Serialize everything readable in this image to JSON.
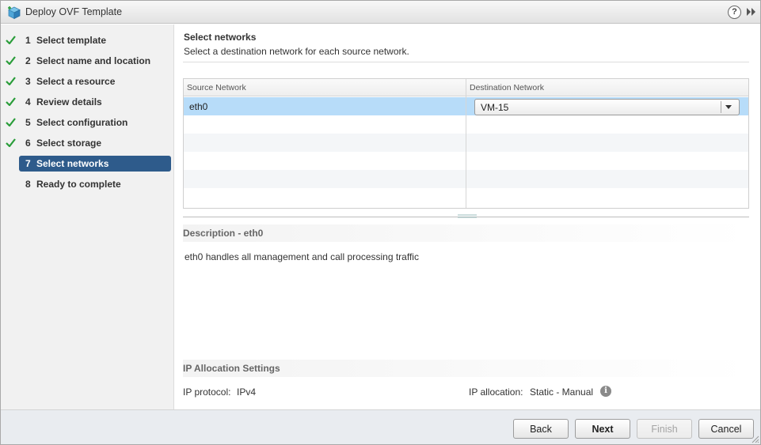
{
  "window": {
    "title": "Deploy OVF Template",
    "help_symbol": "?"
  },
  "colors": {
    "accent": "#2e5b8b",
    "check": "#2a9d3a",
    "selected_row": "#b7dcf9"
  },
  "steps": [
    {
      "num": "1",
      "label": "Select template",
      "done": true
    },
    {
      "num": "2",
      "label": "Select name and location",
      "done": true
    },
    {
      "num": "3",
      "label": "Select a resource",
      "done": true
    },
    {
      "num": "4",
      "label": "Review details",
      "done": true
    },
    {
      "num": "5",
      "label": "Select configuration",
      "done": true
    },
    {
      "num": "6",
      "label": "Select storage",
      "done": true
    },
    {
      "num": "7",
      "label": "Select networks",
      "done": false,
      "active": true
    },
    {
      "num": "8",
      "label": "Ready to complete",
      "done": false
    }
  ],
  "main": {
    "heading": "Select networks",
    "subheading": "Select a destination network for each source network.",
    "grid": {
      "columns": [
        "Source Network",
        "Destination Network"
      ],
      "rows": [
        {
          "source": "eth0",
          "destination": "VM-15"
        }
      ]
    },
    "description": {
      "title": "Description - eth0",
      "text": "eth0 handles all management and call processing traffic"
    },
    "ip": {
      "title": "IP Allocation Settings",
      "protocol_label": "IP protocol:",
      "protocol_value": "IPv4",
      "allocation_label": "IP allocation:",
      "allocation_value": "Static - Manual",
      "info_symbol": "i"
    }
  },
  "footer": {
    "back": "Back",
    "next": "Next",
    "finish": "Finish",
    "cancel": "Cancel"
  }
}
